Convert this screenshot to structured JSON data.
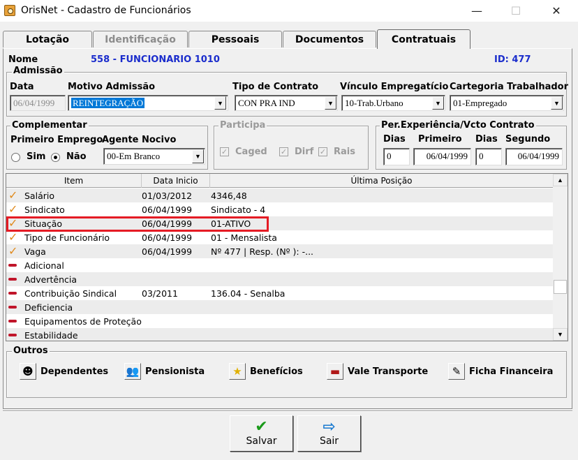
{
  "window": {
    "title": "OrisNet - Cadastro de Funcionários",
    "min": "—",
    "max": "☐",
    "close": "✕"
  },
  "tabs": [
    {
      "label": "Lotação",
      "state": "normal"
    },
    {
      "label": "Identificação",
      "state": "disabled"
    },
    {
      "label": "Pessoais",
      "state": "normal"
    },
    {
      "label": "Documentos",
      "state": "normal"
    },
    {
      "label": "Contratuais",
      "state": "active"
    }
  ],
  "header": {
    "nome_label": "Nome",
    "nome_value": "558 - FUNCIONARIO 1010",
    "id_label": "ID: 477"
  },
  "admissao": {
    "title": "Admissão",
    "data_label": "Data",
    "data_value": "06/04/1999",
    "motivo_label": "Motivo Admissão",
    "motivo_value": "REINTEGRAÇÃO",
    "tipo_label": "Tipo de Contrato",
    "tipo_value": "CON PRA IND",
    "vinculo_label": "Vínculo Empregatício",
    "vinculo_value": "10-Trab.Urbano",
    "categoria_label": "Cartegoria Trabalhador",
    "categoria_value": "01-Empregado"
  },
  "complementar": {
    "title": "Complementar",
    "primeiro_label": "Primeiro Emprego",
    "sim": "Sim",
    "nao": "Não",
    "selected": "Não",
    "agente_label": "Agente Nocivo",
    "agente_value": "00-Em Branco"
  },
  "participa": {
    "title": "Participa",
    "caged": "Caged",
    "dirf": "Dirf",
    "rais": "Rais"
  },
  "experiencia": {
    "title": "Per.Experiência/Vcto Contrato",
    "dias1_label": "Dias",
    "primeiro_label": "Primeiro",
    "dias2_label": "Dias",
    "segundo_label": "Segundo",
    "dias1_value": "0",
    "primeiro_value": "06/04/1999",
    "dias2_value": "0",
    "segundo_value": "06/04/1999"
  },
  "grid": {
    "headers": {
      "item": "Item",
      "data": "Data Inicio",
      "posicao": "Última Posição"
    },
    "rows": [
      {
        "icon": "check",
        "item": "Salário",
        "data": "01/03/2012",
        "posicao": "4346,48"
      },
      {
        "icon": "check",
        "item": "Sindicato",
        "data": "06/04/1999",
        "posicao": "Sindicato - 4"
      },
      {
        "icon": "check",
        "item": "Situação",
        "data": "06/04/1999",
        "posicao": "01-ATIVO"
      },
      {
        "icon": "check",
        "item": "Tipo de Funcionário",
        "data": "06/04/1999",
        "posicao": "01 - Mensalista"
      },
      {
        "icon": "check",
        "item": "Vaga",
        "data": "06/04/1999",
        "posicao": "Nº 477   | Resp. (Nº ): -..."
      },
      {
        "icon": "dash",
        "item": "Adicional",
        "data": "",
        "posicao": ""
      },
      {
        "icon": "dash",
        "item": "Advertência",
        "data": "",
        "posicao": ""
      },
      {
        "icon": "dash",
        "item": "Contribuição Sindical",
        "data": "03/2011",
        "posicao": "136.04 - Senalba"
      },
      {
        "icon": "dash",
        "item": "Deficiencia",
        "data": "",
        "posicao": ""
      },
      {
        "icon": "dash",
        "item": "Equipamentos de Proteção",
        "data": "",
        "posicao": ""
      },
      {
        "icon": "dash",
        "item": "Estabilidade",
        "data": "",
        "posicao": ""
      }
    ]
  },
  "outros": {
    "title": "Outros",
    "buttons": [
      {
        "label": "Dependentes",
        "icon": "dependents-icon"
      },
      {
        "label": "Pensionista",
        "icon": "pensioner-icon"
      },
      {
        "label": "Benefícios",
        "icon": "star-icon"
      },
      {
        "label": "Vale Transporte",
        "icon": "bus-icon"
      },
      {
        "label": "Ficha Financeira",
        "icon": "financial-sheet-icon"
      }
    ]
  },
  "actions": {
    "save": "Salvar",
    "exit": "Sair"
  },
  "colors": {
    "accent_blue": "#1a2ccc",
    "highlight_red": "#e51b24",
    "check_orange": "#e08a1c",
    "dash_red": "#c0152a",
    "selection": "#0078d7"
  }
}
